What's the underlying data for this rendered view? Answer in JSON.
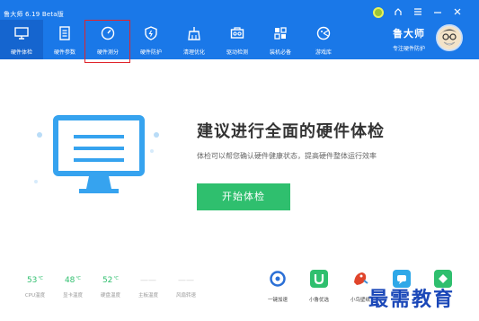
{
  "window": {
    "title": "鲁大师 6.19 Beta版"
  },
  "nav": {
    "items": [
      {
        "label": "硬件体检"
      },
      {
        "label": "硬件参数"
      },
      {
        "label": "硬件测分"
      },
      {
        "label": "硬件防护"
      },
      {
        "label": "清理优化"
      },
      {
        "label": "驱动检测"
      },
      {
        "label": "装机必备"
      },
      {
        "label": "游戏库"
      }
    ],
    "active_index": 0
  },
  "brand": {
    "name": "鲁大师",
    "subtitle": "专注硬件防护"
  },
  "main": {
    "headline": "建议进行全面的硬件体检",
    "subline": "体检可以帮您确认硬件健康状态，提高硬件整体运行效率",
    "start_button": "开始体检"
  },
  "stats": [
    {
      "value": "53",
      "unit": "℃",
      "label": "CPU温度"
    },
    {
      "value": "48",
      "unit": "℃",
      "label": "显卡温度"
    },
    {
      "value": "52",
      "unit": "℃",
      "label": "硬盘温度"
    },
    {
      "value": "——",
      "unit": "",
      "label": "主板温度"
    },
    {
      "value": "——",
      "unit": "",
      "label": "风扇转速"
    }
  ],
  "tools": [
    {
      "label": "一键加速",
      "icon": "speed-ring-icon",
      "color": "#2a6fd6"
    },
    {
      "label": "小鲁优选",
      "icon": "u-shop-icon",
      "color": "#2fbf6e"
    },
    {
      "label": "小鸟壁纸",
      "icon": "bird-wallpaper-icon",
      "color": "#e0442b"
    },
    {
      "label": "",
      "icon": "chat-icon",
      "color": "#2fa8e8"
    },
    {
      "label": "",
      "icon": "green-app-icon",
      "color": "#2fbf6e"
    }
  ],
  "watermark": "最需教育",
  "colors": {
    "header": "#1a78e8",
    "accent_green": "#2fbf6e",
    "highlight": "#e0242b",
    "headline": "#333333"
  }
}
